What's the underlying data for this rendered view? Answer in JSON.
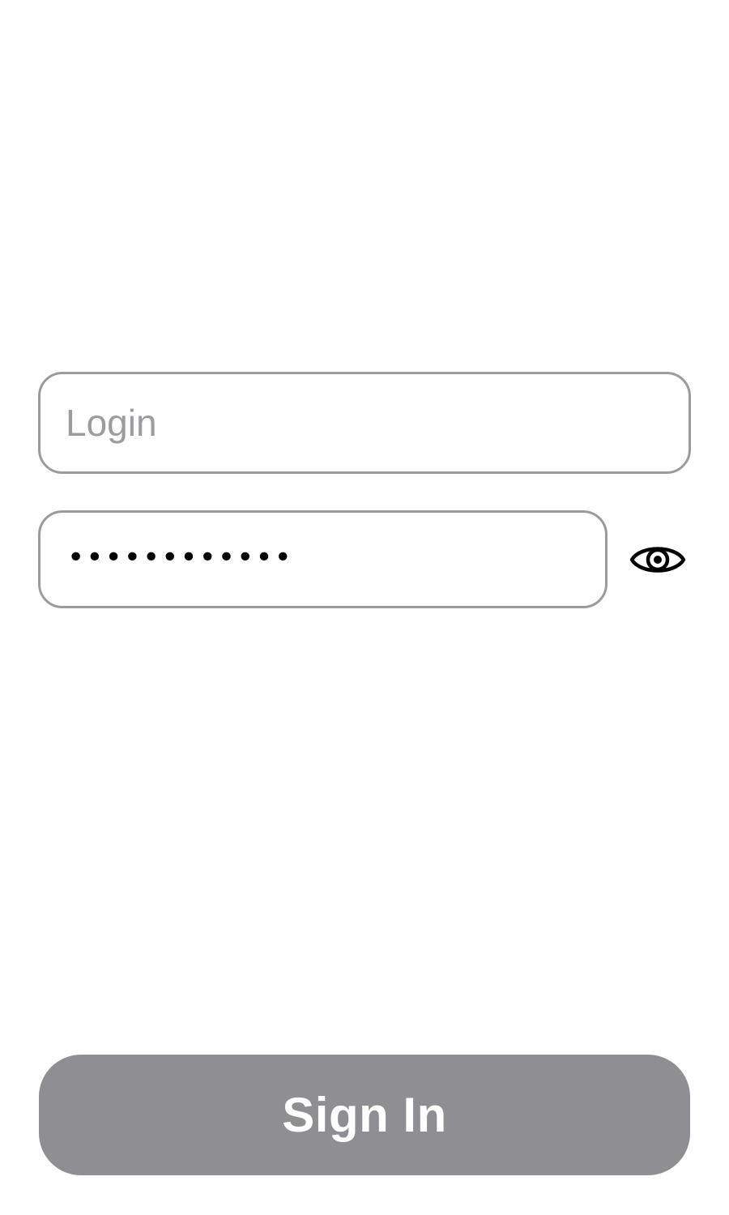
{
  "form": {
    "login": {
      "placeholder": "Login",
      "value": ""
    },
    "password": {
      "masked_value": "••••••••••••"
    },
    "show_password_toggle": {
      "icon": "eye-icon"
    },
    "sign_in": {
      "label": "Sign In",
      "color": "#8e8e93"
    }
  }
}
